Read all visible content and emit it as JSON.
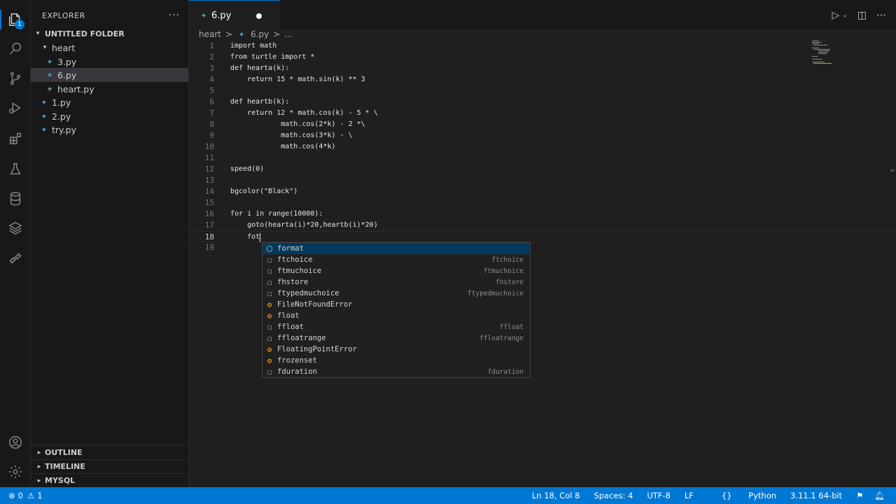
{
  "sidebar": {
    "title": "EXPLORER",
    "more": "···",
    "folder": "UNTITLED FOLDER",
    "tree": [
      {
        "label": "heart",
        "type": "folder",
        "indent": 1
      },
      {
        "label": "3.py",
        "type": "file",
        "indent": 2
      },
      {
        "label": "6.py",
        "type": "file",
        "indent": 2,
        "selected": true
      },
      {
        "label": "heart.py",
        "type": "file",
        "indent": 2
      },
      {
        "label": "1.py",
        "type": "file",
        "indent": 1
      },
      {
        "label": "2.py",
        "type": "file",
        "indent": 1
      },
      {
        "label": "try.py",
        "type": "file",
        "indent": 1
      }
    ],
    "sections": [
      "OUTLINE",
      "TIMELINE",
      "MYSQL"
    ]
  },
  "activity": {
    "badge": "1"
  },
  "tab": {
    "label": "6.py"
  },
  "breadcrumb": {
    "folder": "heart",
    "sep": ">",
    "file": "6.py",
    "more": "..."
  },
  "code_lines": [
    "import math",
    "from turtle import *",
    "def hearta(k):",
    "    return 15 * math.sin(k) ** 3",
    "",
    "def heartb(k):",
    "    return 12 * math.cos(k) - 5 * \\",
    "            math.cos(2*k) - 2 *\\",
    "            math.cos(3*k) - \\",
    "            math.cos(4*k)",
    "",
    "speed(0)",
    "",
    "bgcolor(\"Black\")",
    "",
    "for i in range(10000):",
    "    goto(hearta(i)*20,heartb(i)*20)",
    "    fot",
    ""
  ],
  "current_line": 18,
  "suggestions": [
    {
      "label": "format",
      "detail": "",
      "icon": "cube"
    },
    {
      "label": "ftchoice",
      "detail": "ftchoice",
      "icon": "square"
    },
    {
      "label": "ftmuchoice",
      "detail": "ftmuchoice",
      "icon": "square"
    },
    {
      "label": "fhstore",
      "detail": "fhstore",
      "icon": "square"
    },
    {
      "label": "ftypedmuchoice",
      "detail": "ftypedmuchoice",
      "icon": "square"
    },
    {
      "label": "FileNotFoundError",
      "detail": "",
      "icon": "class"
    },
    {
      "label": "float",
      "detail": "",
      "icon": "class"
    },
    {
      "label": "ffloat",
      "detail": "ffloat",
      "icon": "square"
    },
    {
      "label": "ffloatrange",
      "detail": "ffloatrange",
      "icon": "square"
    },
    {
      "label": "FloatingPointError",
      "detail": "",
      "icon": "class"
    },
    {
      "label": "frozenset",
      "detail": "",
      "icon": "class"
    },
    {
      "label": "fduration",
      "detail": "fduration",
      "icon": "square"
    }
  ],
  "status": {
    "errors": "0",
    "warnings": "1",
    "position": "Ln 18, Col 8",
    "spaces": "Spaces: 4",
    "encoding": "UTF-8",
    "eol": "LF",
    "language": "Python",
    "interpreter": "3.11.1 64-bit"
  },
  "colors": {
    "accent": "#0078d4",
    "keyword": "#e6e6e6",
    "linenumber": "#6e7681"
  }
}
